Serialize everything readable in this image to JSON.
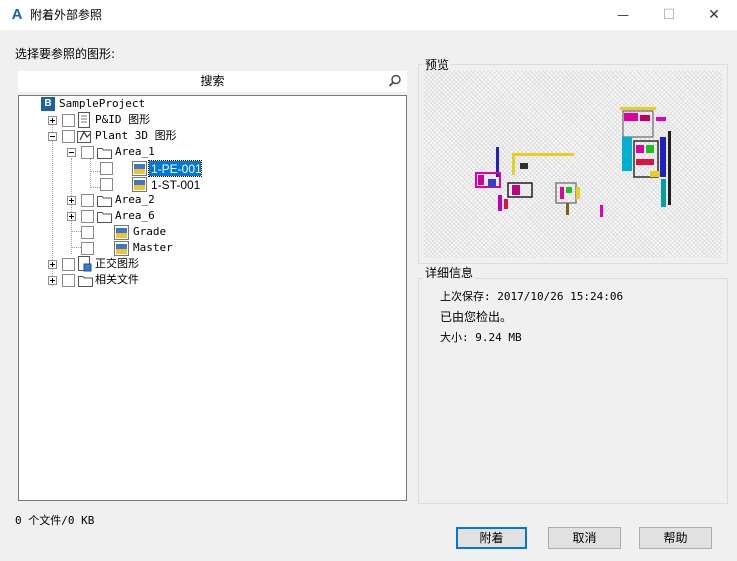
{
  "window": {
    "title": "附着外部参照",
    "minimize_glyph": "—",
    "maximize_glyph": "☐",
    "close_glyph": "✕"
  },
  "left": {
    "section_label": "选择要参照的图形:",
    "search_label": "搜索"
  },
  "tree": {
    "root": "SampleProject",
    "root_icon_letter": "B",
    "pid": "P&ID 图形",
    "plant3d": "Plant 3D 图形",
    "area1": "Area_1",
    "pe001": "1-PE-001",
    "st001": "1-ST-001",
    "area2": "Area_2",
    "area6": "Area_6",
    "grade": "Grade",
    "master": "Master",
    "ortho": "正交图形",
    "related": "相关文件"
  },
  "right": {
    "preview_label": "预览",
    "details_label": "详细信息",
    "last_saved": "上次保存: 2017/10/26 15:24:06",
    "checked_in": "已由您检出。",
    "size": "大小:  9.24 MB"
  },
  "footer": {
    "file_count": "0 个文件/0 KB",
    "attach": "附着",
    "cancel": "取消",
    "help": "帮助"
  },
  "colors": {
    "selection": "#0078d7",
    "default_button_border": "#0078d7",
    "app_icon": "#1a5fa8"
  }
}
